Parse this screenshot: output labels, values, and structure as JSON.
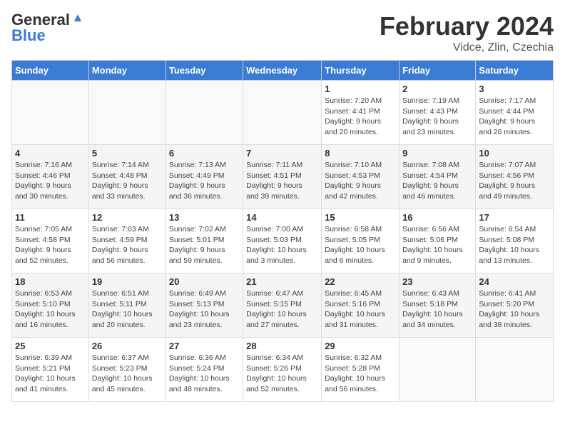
{
  "header": {
    "logo_general": "General",
    "logo_blue": "Blue",
    "month_year": "February 2024",
    "location": "Vidce, Zlin, Czechia"
  },
  "days_of_week": [
    "Sunday",
    "Monday",
    "Tuesday",
    "Wednesday",
    "Thursday",
    "Friday",
    "Saturday"
  ],
  "weeks": [
    {
      "row_class": "row-odd",
      "days": [
        {
          "num": "",
          "info": "",
          "empty": true
        },
        {
          "num": "",
          "info": "",
          "empty": true
        },
        {
          "num": "",
          "info": "",
          "empty": true
        },
        {
          "num": "",
          "info": "",
          "empty": true
        },
        {
          "num": "1",
          "info": "Sunrise: 7:20 AM\nSunset: 4:41 PM\nDaylight: 9 hours\nand 20 minutes."
        },
        {
          "num": "2",
          "info": "Sunrise: 7:19 AM\nSunset: 4:43 PM\nDaylight: 9 hours\nand 23 minutes."
        },
        {
          "num": "3",
          "info": "Sunrise: 7:17 AM\nSunset: 4:44 PM\nDaylight: 9 hours\nand 26 minutes."
        }
      ]
    },
    {
      "row_class": "row-even",
      "days": [
        {
          "num": "4",
          "info": "Sunrise: 7:16 AM\nSunset: 4:46 PM\nDaylight: 9 hours\nand 30 minutes."
        },
        {
          "num": "5",
          "info": "Sunrise: 7:14 AM\nSunset: 4:48 PM\nDaylight: 9 hours\nand 33 minutes."
        },
        {
          "num": "6",
          "info": "Sunrise: 7:13 AM\nSunset: 4:49 PM\nDaylight: 9 hours\nand 36 minutes."
        },
        {
          "num": "7",
          "info": "Sunrise: 7:11 AM\nSunset: 4:51 PM\nDaylight: 9 hours\nand 39 minutes."
        },
        {
          "num": "8",
          "info": "Sunrise: 7:10 AM\nSunset: 4:53 PM\nDaylight: 9 hours\nand 42 minutes."
        },
        {
          "num": "9",
          "info": "Sunrise: 7:08 AM\nSunset: 4:54 PM\nDaylight: 9 hours\nand 46 minutes."
        },
        {
          "num": "10",
          "info": "Sunrise: 7:07 AM\nSunset: 4:56 PM\nDaylight: 9 hours\nand 49 minutes."
        }
      ]
    },
    {
      "row_class": "row-odd",
      "days": [
        {
          "num": "11",
          "info": "Sunrise: 7:05 AM\nSunset: 4:58 PM\nDaylight: 9 hours\nand 52 minutes."
        },
        {
          "num": "12",
          "info": "Sunrise: 7:03 AM\nSunset: 4:59 PM\nDaylight: 9 hours\nand 56 minutes."
        },
        {
          "num": "13",
          "info": "Sunrise: 7:02 AM\nSunset: 5:01 PM\nDaylight: 9 hours\nand 59 minutes."
        },
        {
          "num": "14",
          "info": "Sunrise: 7:00 AM\nSunset: 5:03 PM\nDaylight: 10 hours\nand 3 minutes."
        },
        {
          "num": "15",
          "info": "Sunrise: 6:58 AM\nSunset: 5:05 PM\nDaylight: 10 hours\nand 6 minutes."
        },
        {
          "num": "16",
          "info": "Sunrise: 6:56 AM\nSunset: 5:06 PM\nDaylight: 10 hours\nand 9 minutes."
        },
        {
          "num": "17",
          "info": "Sunrise: 6:54 AM\nSunset: 5:08 PM\nDaylight: 10 hours\nand 13 minutes."
        }
      ]
    },
    {
      "row_class": "row-even",
      "days": [
        {
          "num": "18",
          "info": "Sunrise: 6:53 AM\nSunset: 5:10 PM\nDaylight: 10 hours\nand 16 minutes."
        },
        {
          "num": "19",
          "info": "Sunrise: 6:51 AM\nSunset: 5:11 PM\nDaylight: 10 hours\nand 20 minutes."
        },
        {
          "num": "20",
          "info": "Sunrise: 6:49 AM\nSunset: 5:13 PM\nDaylight: 10 hours\nand 23 minutes."
        },
        {
          "num": "21",
          "info": "Sunrise: 6:47 AM\nSunset: 5:15 PM\nDaylight: 10 hours\nand 27 minutes."
        },
        {
          "num": "22",
          "info": "Sunrise: 6:45 AM\nSunset: 5:16 PM\nDaylight: 10 hours\nand 31 minutes."
        },
        {
          "num": "23",
          "info": "Sunrise: 6:43 AM\nSunset: 5:18 PM\nDaylight: 10 hours\nand 34 minutes."
        },
        {
          "num": "24",
          "info": "Sunrise: 6:41 AM\nSunset: 5:20 PM\nDaylight: 10 hours\nand 38 minutes."
        }
      ]
    },
    {
      "row_class": "row-odd",
      "days": [
        {
          "num": "25",
          "info": "Sunrise: 6:39 AM\nSunset: 5:21 PM\nDaylight: 10 hours\nand 41 minutes."
        },
        {
          "num": "26",
          "info": "Sunrise: 6:37 AM\nSunset: 5:23 PM\nDaylight: 10 hours\nand 45 minutes."
        },
        {
          "num": "27",
          "info": "Sunrise: 6:36 AM\nSunset: 5:24 PM\nDaylight: 10 hours\nand 48 minutes."
        },
        {
          "num": "28",
          "info": "Sunrise: 6:34 AM\nSunset: 5:26 PM\nDaylight: 10 hours\nand 52 minutes."
        },
        {
          "num": "29",
          "info": "Sunrise: 6:32 AM\nSunset: 5:28 PM\nDaylight: 10 hours\nand 56 minutes."
        },
        {
          "num": "",
          "info": "",
          "empty": true
        },
        {
          "num": "",
          "info": "",
          "empty": true
        }
      ]
    }
  ]
}
